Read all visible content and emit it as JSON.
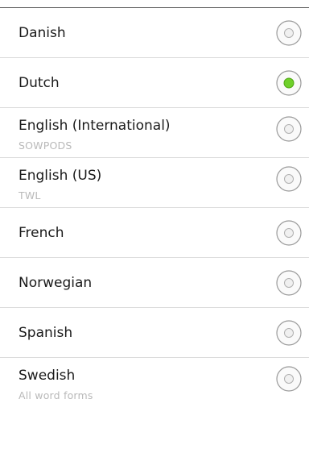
{
  "languages": [
    {
      "label": "Danish",
      "sublabel": "",
      "selected": false
    },
    {
      "label": "Dutch",
      "sublabel": "",
      "selected": true
    },
    {
      "label": "English (International)",
      "sublabel": "SOWPODS",
      "selected": false
    },
    {
      "label": "English (US)",
      "sublabel": "TWL",
      "selected": false
    },
    {
      "label": "French",
      "sublabel": "",
      "selected": false
    },
    {
      "label": "Norwegian",
      "sublabel": "",
      "selected": false
    },
    {
      "label": "Spanish",
      "sublabel": "",
      "selected": false
    },
    {
      "label": "Swedish",
      "sublabel": "All word forms",
      "selected": false
    }
  ],
  "colors": {
    "radio_selected": "#6fd02a",
    "radio_ring": "#9a9a9a",
    "sublabel": "#b9b9b9",
    "divider": "#dcdcdc"
  }
}
